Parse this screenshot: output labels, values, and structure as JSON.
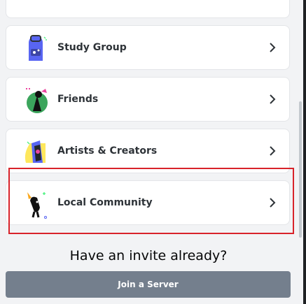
{
  "servers": [
    {
      "label": "Study Group",
      "icon": "study-group-icon"
    },
    {
      "label": "Friends",
      "icon": "friends-icon"
    },
    {
      "label": "Artists & Creators",
      "icon": "artists-creators-icon"
    },
    {
      "label": "Local Community",
      "icon": "local-community-icon"
    }
  ],
  "invite": {
    "title": "Have an invite already?",
    "button_label": "Join a Server"
  },
  "colors": {
    "button": "#747f8d",
    "highlight": "#d8232a",
    "card": "#ffffff",
    "background": "#f2f3f5"
  }
}
